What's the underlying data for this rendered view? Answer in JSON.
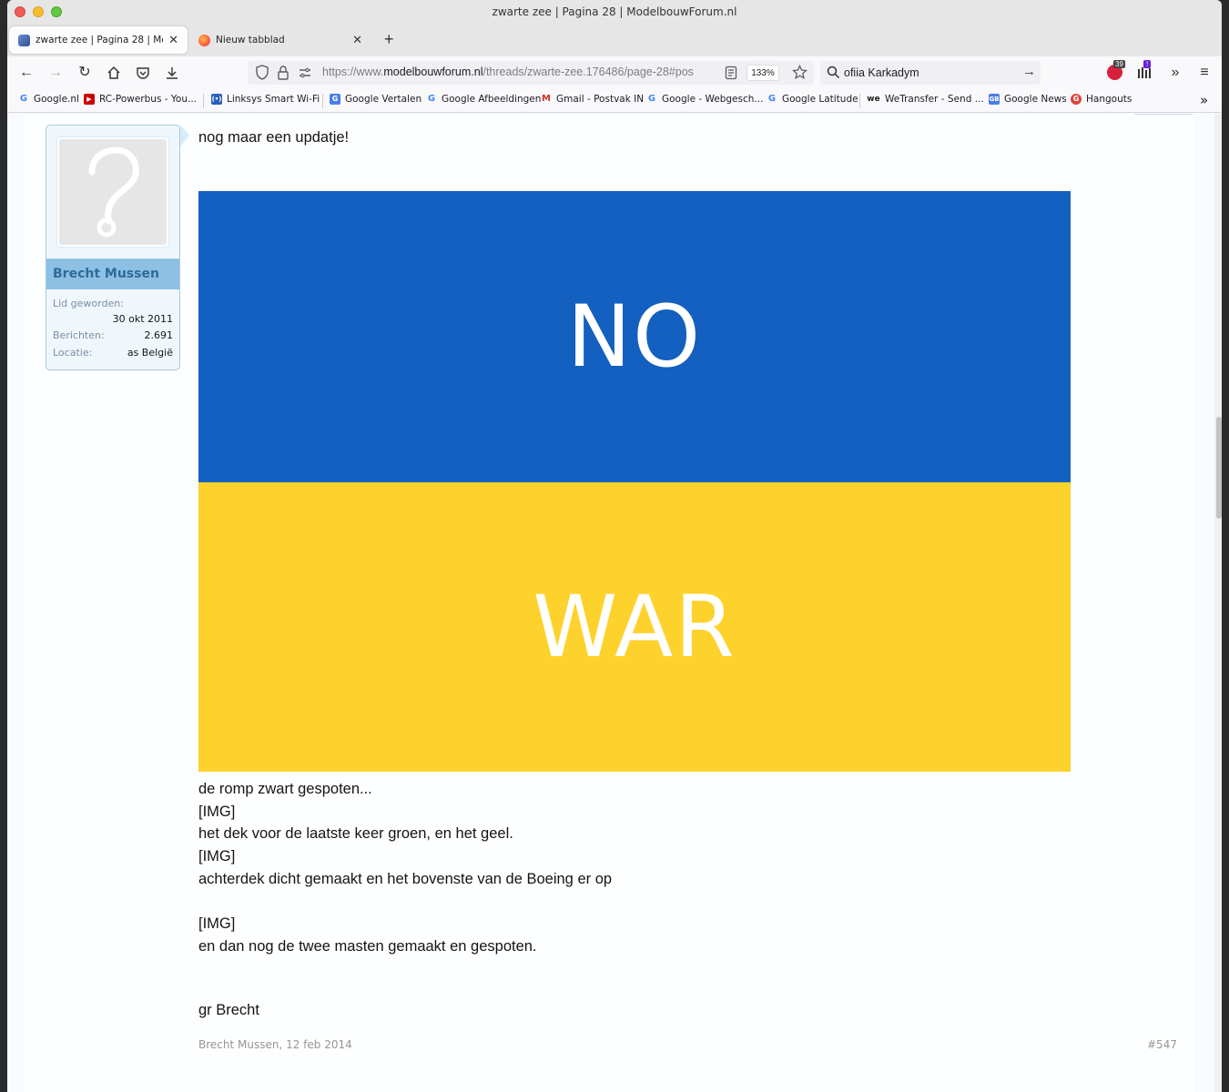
{
  "window": {
    "title": "zwarte zee | Pagina 28 | ModelbouwForum.nl"
  },
  "tabs": [
    {
      "label": "zwarte zee | Pagina 28 | Modelbouw"
    },
    {
      "label": "Nieuw tabblad"
    }
  ],
  "nav": {
    "url_prefix": "https://www.",
    "url_domain": "modelbouwforum.nl",
    "url_rest": "/threads/zwarte-zee.176486/page-28#pos",
    "zoom": "133%",
    "search_value": "ofiia Karkadym",
    "ext_badge_1": "39",
    "ext_badge_2": "!"
  },
  "bookmarks": [
    {
      "label": "Google.nl",
      "icon": "google-icon"
    },
    {
      "label": "RC-Powerbus - You...",
      "icon": "youtube-icon"
    },
    {
      "label": "Linksys Smart Wi-Fi",
      "icon": "linksys-icon"
    },
    {
      "label": "Google Vertalen",
      "icon": "translate-icon"
    },
    {
      "label": "Google Afbeeldingen",
      "icon": "google-icon"
    },
    {
      "label": "Gmail - Postvak IN",
      "icon": "gmail-icon"
    },
    {
      "label": "Google - Webgesch...",
      "icon": "google-icon"
    },
    {
      "label": "Google Latitude",
      "icon": "google-icon"
    },
    {
      "label": "WeTransfer - Send ...",
      "icon": "wetransfer-icon"
    },
    {
      "label": "Google News",
      "icon": "news-icon"
    },
    {
      "label": "Hangouts",
      "icon": "hangouts-icon"
    }
  ],
  "user": {
    "name": "Brecht Mussen",
    "joined_label": "Lid geworden:",
    "joined_value": "30 okt 2011",
    "posts_label": "Berichten:",
    "posts_value": "2.691",
    "location_label": "Locatie:",
    "location_value": "as België"
  },
  "post": {
    "intro": "nog maar een updatje!",
    "flag_top": "NO",
    "flag_bottom": "WAR",
    "lines": [
      "de romp zwart gespoten...",
      "[IMG]",
      "het dek voor de laatste keer groen, en het geel.",
      "[IMG]",
      "achterdek dicht gemaakt en het bovenste van de Boeing er op",
      "",
      "[IMG]",
      "en dan nog de twee masten gemaakt en gespoten."
    ],
    "signoff": "gr Brecht",
    "meta": "Brecht Mussen, 12 feb 2014",
    "number": "#547"
  },
  "colors": {
    "flag_blue": "#1360c0",
    "flag_yellow": "#fdd22d",
    "username_bar": "#8dc0e3"
  }
}
